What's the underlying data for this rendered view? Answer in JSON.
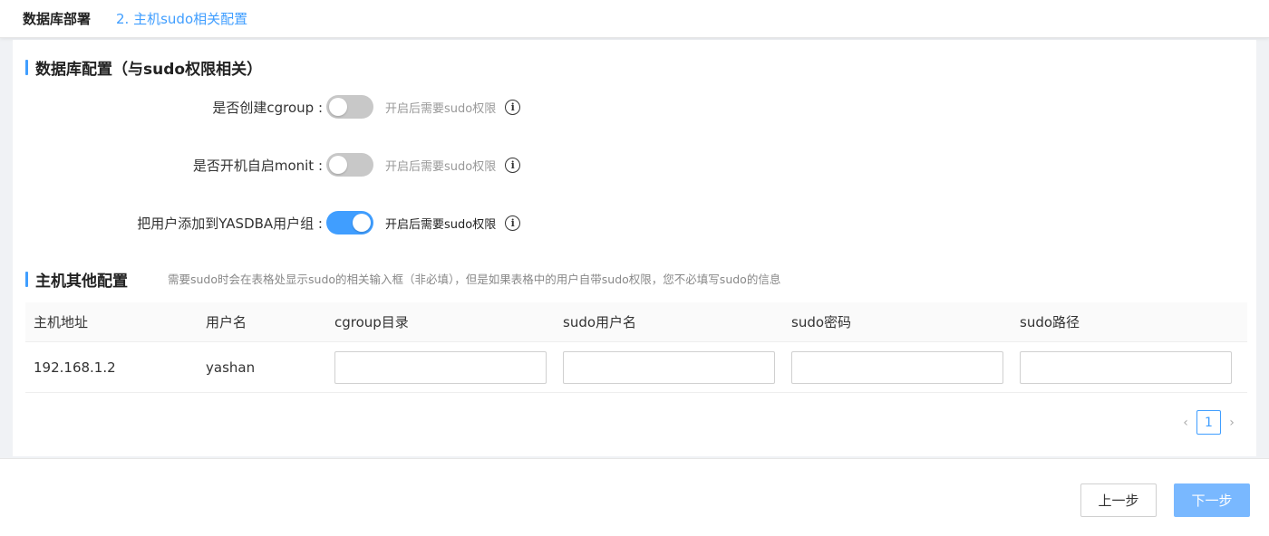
{
  "header": {
    "title": "数据库部署",
    "step": "2. 主机sudo相关配置"
  },
  "db_config": {
    "title": "数据库配置（与sudo权限相关）",
    "rows": [
      {
        "label": "是否创建cgroup :",
        "enabled": false,
        "hint": "开启后需要sudo权限"
      },
      {
        "label": "是否开机自启monit :",
        "enabled": false,
        "hint": "开启后需要sudo权限"
      },
      {
        "label": "把用户添加到YASDBA用户组 :",
        "enabled": true,
        "hint": "开启后需要sudo权限"
      }
    ],
    "info_glyph": "i"
  },
  "host_config": {
    "title": "主机其他配置",
    "note": "需要sudo时会在表格处显示sudo的相关输入框（非必填），但是如果表格中的用户自带sudo权限，您不必填写sudo的信息",
    "columns": [
      "主机地址",
      "用户名",
      "cgroup目录",
      "sudo用户名",
      "sudo密码",
      "sudo路径"
    ],
    "rows": [
      {
        "host": "192.168.1.2",
        "user": "yashan",
        "cgroup_dir": "",
        "sudo_user": "",
        "sudo_password": "",
        "sudo_path": ""
      }
    ]
  },
  "pagination": {
    "prev": "‹",
    "current": "1",
    "next": "›"
  },
  "footer": {
    "prev_label": "上一步",
    "next_label": "下一步"
  },
  "colors": {
    "accent": "#409eff",
    "next_button": "#79b8ff"
  }
}
